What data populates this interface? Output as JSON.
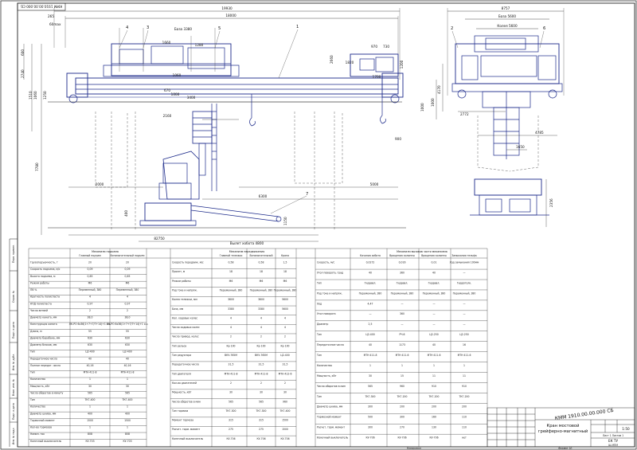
{
  "sheet": {
    "stamp_top": "КММ 1910.00.00.000 СБ",
    "designation": "КММ 1910.00.00.000 СБ",
    "title_line1": "Кран мостовой",
    "title_line2": "грейферно-магнитный",
    "scale": "1:50",
    "org": "ЕК ТУ",
    "group": "Ш-МПМ",
    "sheet_info": "Лист 1 Листов 1",
    "format_label": "Формат А1",
    "copied_label": "Копировал"
  },
  "front_view": {
    "overall_dim": "19930",
    "span_dim": "18000",
    "dim_265": "265",
    "dim_60": "60max",
    "base_dim": "База 3380",
    "dim_1660": "1660",
    "dim_1280": "1280",
    "dim_1060": "1060",
    "dim_670": "670",
    "dim_1000": "1000",
    "dim_3400": "3400",
    "dim_2160": "2160",
    "dim_2000": "2000",
    "dim_5000": "5000",
    "dim_6300": "6300",
    "dim_900": "900",
    "dim_82750": "82750",
    "dim_970": "970",
    "dim_730": "730",
    "dim_1820": "1820",
    "dim_1700": "1700",
    "dim_1200": "1200",
    "dim_400": "400",
    "dim_1150": "1150",
    "hook_dim": "Вылет хобота 4800",
    "h_2740": "2740",
    "h_1510": "1510",
    "h_1060": "1060",
    "h_7780": "7780",
    "h_600": "600",
    "h_1250": "1250",
    "h_1000": "1000",
    "h_2660": "2660",
    "callouts": [
      "4",
      "3",
      "5",
      "1",
      "7",
      "2",
      "6"
    ]
  },
  "side_view": {
    "overall_dim": "8757",
    "base_dim": "База 5600",
    "track_dim": "Колея 5600",
    "dim_2772": "2772",
    "dim_4785": "4785",
    "dim_1650": "1650",
    "dim_2356": "2356",
    "h_1000": "1000",
    "h_4170": "4170"
  },
  "spec": {
    "col1_header": "Механизм подъема",
    "col1_sub1": "Главный подъем",
    "col1_sub2": "Вспомогательный подъем",
    "col2_header": "Механизм передвижения",
    "col2_sub1": "Главной тележки",
    "col2_sub2": "Вспомогательной",
    "col2_sub3": "Крана",
    "col3_header": "Механизм вызовов части механизма",
    "col3_sub1": "Качания хобота",
    "col3_sub2": "Вращения колонны",
    "col3_sub3": "Вращения колонны",
    "col3_sub4": "Замыкания тельфа",
    "rows_left": [
      "Грузоподъемность, т",
      "Скорость подъема, м/с",
      "Высота подъема, м",
      "Режим работы",
      "ПВ %",
      "Кратность полиспаста",
      "КПД полиспаста",
      "Число ветвей",
      "Диаметр каната, мм",
      "Конструкция каната",
      "Длина, м",
      "Диаметр барабана, мм",
      "Диаметр блоков, мм",
      "Тип",
      "Передаточное число",
      "Полное передат. число",
      "Тип",
      "Количество",
      "Мощность, кВт",
      "Число оборотов в минуту",
      "Тип",
      "Количество",
      "Диаметр шкива, мм",
      "Тормозной момент",
      "Кол-во тормозов",
      "Номин. ток",
      "Конечный выключатель"
    ],
    "vals_main": [
      "20",
      "0,09",
      "0,65",
      "М6",
      "Переменный, 380",
      "4",
      "0,97",
      "2",
      "38,0",
      "ЛК-РО 6x36(1+7+7/7+14)+1 о.с.",
      "55",
      "630",
      "630",
      "Ц2-400",
      "40",
      "40,16",
      "МТН 411-8",
      "1",
      "30",
      "565",
      "ТКГ-400",
      "1",
      "400",
      "1500",
      "1",
      "808",
      "КУ-703"
    ],
    "vals_aux": [
      "20",
      "0,09",
      "0,65",
      "М6",
      "Переменный, 380",
      "4",
      "0,97",
      "2",
      "38,0",
      "ЛК-РО 6x36(1+7+7/7+14)+1 о.с.",
      "55",
      "630",
      "630",
      "Ц2-400",
      "40",
      "40,16",
      "МТН 411-8",
      "1",
      "30",
      "565",
      "ТКГ-400",
      "1",
      "400",
      "1500",
      "1",
      "808",
      "КУ-703"
    ],
    "rows_mid": [
      "Скорость передвиж. м/с",
      "Пролет, м",
      "Режим работы",
      "Род тока и напряж.",
      "Колея тележки, мм",
      "База, мм",
      "Кол. ходовых колес",
      "Число ходовых колес",
      "Число привод. колес",
      "Тип рельса",
      "Тип редуктора",
      "Передаточное число",
      "Тип двигателя",
      "Кол-во двигателей",
      "Мощность, кВт",
      "Число оборотов в мин",
      "Тип тормоза",
      "Момент тормоза",
      "Расчет. торм. момент",
      "Конечный выключатель"
    ],
    "vals_mid1": [
      "0,58",
      "18",
      "М6",
      "Переменный, 380",
      "3600",
      "3380",
      "4",
      "4",
      "2",
      "Кр 100",
      "ВКУ-765М",
      "31,5",
      "МТН 411-8",
      "2",
      "30",
      "565",
      "ТКГ-300",
      "315",
      "275",
      "КУ-706"
    ],
    "vals_mid2": [
      "0,58",
      "18",
      "М6",
      "Переменный, 380",
      "3600",
      "3380",
      "4",
      "4",
      "2",
      "Кр 100",
      "ВКУ-765М",
      "31,5",
      "МТН 411-8",
      "2",
      "30",
      "565",
      "ТКГ-300",
      "315",
      "275",
      "КУ-706"
    ],
    "vals_mid3": [
      "1,5",
      "18",
      "М6",
      "Переменный, 380",
      "5600",
      "5600",
      "4",
      "4",
      "2",
      "Кр 100",
      "Ц2-400",
      "31,5",
      "МТН 412-6",
      "2",
      "30",
      "960",
      "ТКГ-400",
      "1500",
      "1500",
      "КУ-706"
    ],
    "rows_right": [
      "Скорость, м/с",
      "Угол поворота, град",
      "Тип",
      "Род тока и напряж.",
      "Ход",
      "Угол поворота",
      "Диаметр",
      "Тип",
      "Передаточное число",
      "Тип",
      "Количество",
      "Мощность, кВт",
      "Число оборотов в мин",
      "Тип",
      "Диаметр шкива, мм",
      "Тормозной момент",
      "Расчет. торм. момент",
      "Конечный выключатель"
    ],
    "vals_r1": [
      "0,0272",
      "40",
      "Гидравл.",
      "Переменный, 380",
      "4,47",
      "—",
      "2,5",
      "Ц2-400",
      "40",
      "МТН 411-8",
      "1",
      "30",
      "565",
      "ТКГ-300",
      "300",
      "500",
      "300",
      "КУ-706"
    ],
    "vals_r2": [
      "0,016",
      "360",
      "Гидравл.",
      "Переменный, 380",
      "—",
      "360",
      "—",
      "РЧ-6",
      "1173",
      "МТН 411-6",
      "1",
      "15",
      "960",
      "ТКГ-200",
      "200",
      "300",
      "270",
      "КУ-706"
    ],
    "vals_r3": [
      "0,01",
      "40",
      "Гидравл.",
      "Переменный, 380",
      "—",
      "—",
      "—",
      "Ц2-250",
      "40",
      "МТН 411-6",
      "1",
      "11",
      "910",
      "ТКГ-200",
      "200",
      "160",
      "130",
      "КУ-706"
    ],
    "vals_r4": [
      "Ход замыкания 100мм",
      "—",
      "Гидротолк.",
      "Переменный, 380",
      "—",
      "—",
      "—",
      "Ц2-250",
      "16",
      "МТН 411-6",
      "1",
      "11",
      "910",
      "ТКГ-200",
      "200",
      "110",
      "110",
      "нет"
    ]
  },
  "stamp": {
    "left_labels": [
      "Перв. примен.",
      "Справ. №",
      "Подп. и дата",
      "Инв. № дубл.",
      "Взам. инв. №",
      "Подп. и дата",
      "Инв. № подл."
    ]
  }
}
